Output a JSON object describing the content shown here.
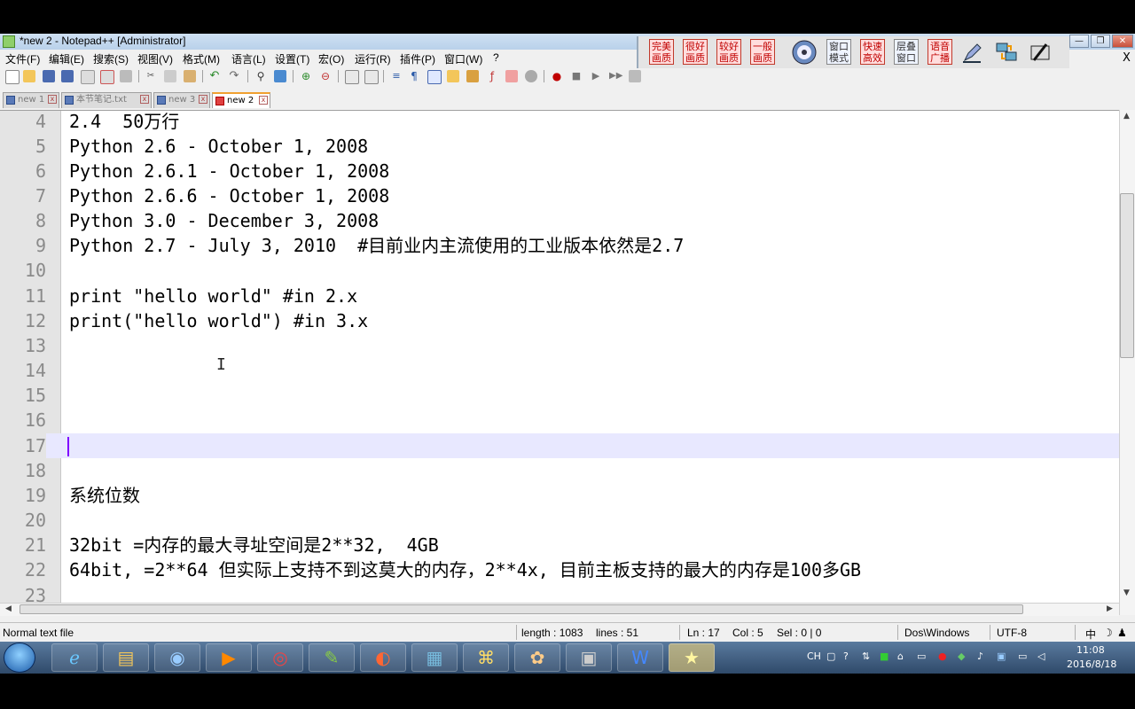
{
  "window": {
    "title": "*new 2 - Notepad++ [Administrator]",
    "min_label": "—",
    "max_label": "❐",
    "close_label": "✕",
    "doc_close_label": "X"
  },
  "menu": [
    "文件(F)",
    "编辑(E)",
    "搜索(S)",
    "视图(V)",
    "格式(M)",
    "语言(L)",
    "设置(T)",
    "宏(O)",
    "运行(R)",
    "插件(P)",
    "窗口(W)",
    "?"
  ],
  "plugin_buttons": [
    {
      "label": "完美画质",
      "style": "red"
    },
    {
      "label": "很好画质",
      "style": "red"
    },
    {
      "label": "较好画质",
      "style": "red"
    },
    {
      "label": "一般画质",
      "style": "red"
    },
    {
      "label": "窗口模式",
      "style": "blue"
    },
    {
      "label": "快速高效",
      "style": "red"
    },
    {
      "label": "层叠窗口",
      "style": "blue"
    },
    {
      "label": "语音广播",
      "style": "red"
    }
  ],
  "tabs": [
    {
      "label": "new 1",
      "active": false
    },
    {
      "label": "本节笔记.txt",
      "active": false
    },
    {
      "label": "new 3",
      "active": false
    },
    {
      "label": "new 2",
      "active": true
    }
  ],
  "editor": {
    "lines": [
      {
        "n": "4",
        "text": "2.4  50万行"
      },
      {
        "n": "5",
        "text": "Python 2.6 - October 1, 2008"
      },
      {
        "n": "6",
        "text": "Python 2.6.1 - October 1, 2008"
      },
      {
        "n": "7",
        "text": "Python 2.6.6 - October 1, 2008"
      },
      {
        "n": "8",
        "text": "Python 3.0 - December 3, 2008"
      },
      {
        "n": "9",
        "text": "Python 2.7 - July 3, 2010  #目前业内主流使用的工业版本依然是2.7"
      },
      {
        "n": "10",
        "text": ""
      },
      {
        "n": "11",
        "text": "print \"hello world\" #in 2.x"
      },
      {
        "n": "12",
        "text": "print(\"hello world\") #in 3.x"
      },
      {
        "n": "13",
        "text": ""
      },
      {
        "n": "14",
        "text": ""
      },
      {
        "n": "15",
        "text": ""
      },
      {
        "n": "16",
        "text": ""
      },
      {
        "n": "17",
        "text": "",
        "current": true
      },
      {
        "n": "18",
        "text": ""
      },
      {
        "n": "19",
        "text": "系统位数"
      },
      {
        "n": "20",
        "text": ""
      },
      {
        "n": "21",
        "text": "32bit =内存的最大寻址空间是2**32,  4GB"
      },
      {
        "n": "22",
        "text": "64bit, =2**64 但实际上支持不到这莫大的内存，2**4x, 目前主板支持的最大的内存是100多GB"
      },
      {
        "n": "23",
        "text": ""
      }
    ]
  },
  "status": {
    "file_type": "Normal text file",
    "length": "length : 1083",
    "lines": "lines : 51",
    "ln": "Ln : 17",
    "col": "Col : 5",
    "sel": "Sel : 0 | 0",
    "eol": "Dos\\Windows",
    "encoding": "UTF-8",
    "ime": "中"
  },
  "taskbar": {
    "lang": "CH",
    "time": "11:08",
    "date": "2016/8/18"
  }
}
